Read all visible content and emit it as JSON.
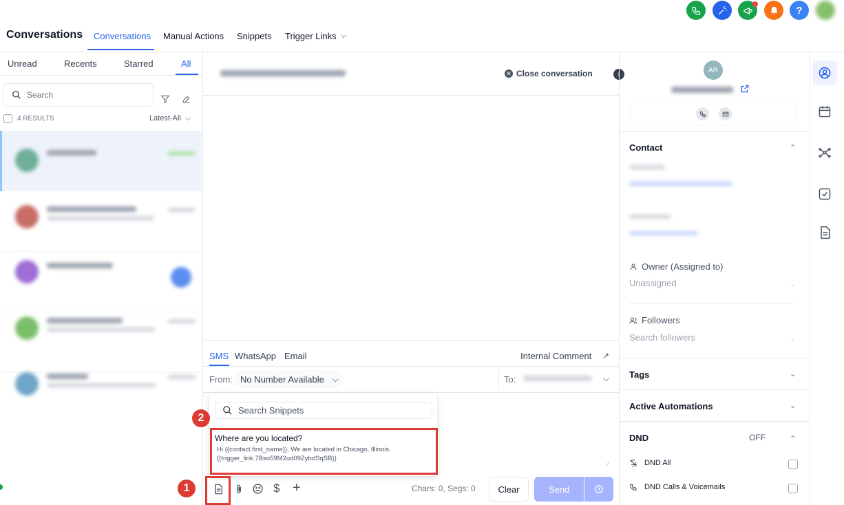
{
  "header": {
    "title": "Conversations",
    "tabs": [
      "Conversations",
      "Manual Actions",
      "Snippets",
      "Trigger Links"
    ]
  },
  "left_panel": {
    "filters": [
      "Unread",
      "Recents",
      "Starred",
      "All"
    ],
    "search_placeholder": "Search",
    "results": "4 RESULTS",
    "sort": "Latest-All"
  },
  "conversation": {
    "close_label": "Close conversation"
  },
  "composer": {
    "channels": [
      "SMS",
      "WhatsApp",
      "Email"
    ],
    "internal_comment": "Internal Comment",
    "from_label": "From:",
    "from_value": "No Number Available",
    "to_label": "To:",
    "chars": "Chars: 0, Segs: 0",
    "clear_label": "Clear",
    "send_label": "Send"
  },
  "snippets": {
    "search_placeholder": "Search Snippets",
    "item_title": "Where are you located?",
    "item_body_1": "Hi {{contact.first_name}}, We are located in Chicago, Illinois.",
    "item_body_2": "{{trigger_link.7Bso59M2ud09ZybdSqSB}}"
  },
  "annotations": {
    "badge_1": "1",
    "badge_2": "2"
  },
  "contact_panel": {
    "avatar_initials": "AR",
    "contact_label": "Contact",
    "owner_label": "Owner (Assigned to)",
    "owner_value": "Unassigned",
    "followers_label": "Followers",
    "followers_placeholder": "Search followers",
    "tags_label": "Tags",
    "automations_label": "Active Automations",
    "dnd_label": "DND",
    "dnd_status": "OFF",
    "dnd_all": "DND All",
    "dnd_calls": "DND Calls & Voicemails"
  },
  "colors": {
    "accent": "#2563eb",
    "annotation": "#dc3a32",
    "send": "#a5b4fc"
  }
}
